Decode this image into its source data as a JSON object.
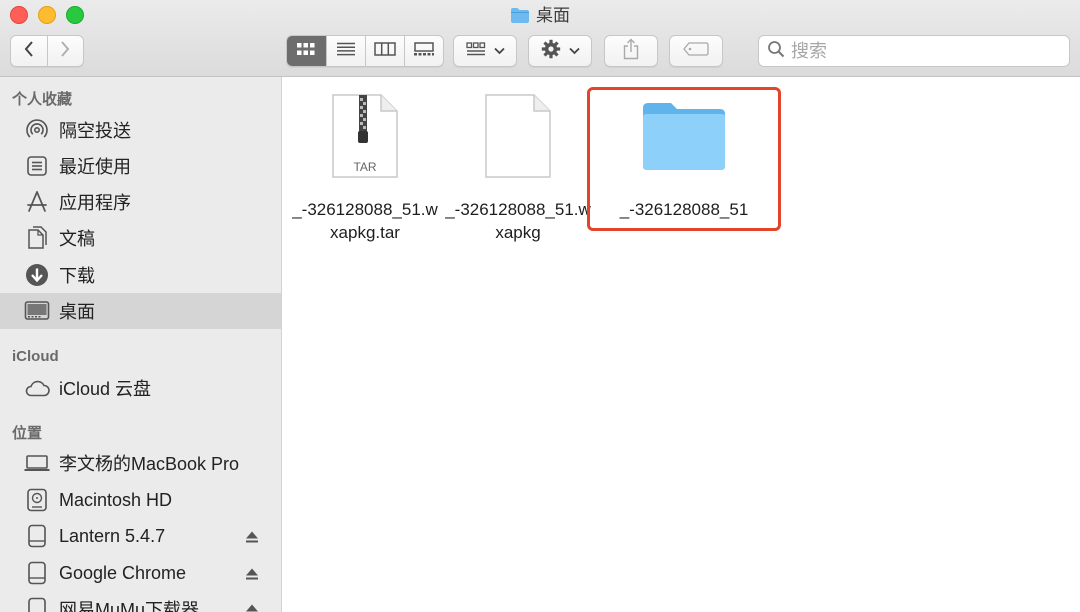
{
  "window": {
    "title": "桌面"
  },
  "toolbar": {
    "back_icon": "chevron-left-icon",
    "forward_icon": "chevron-right-icon",
    "views": [
      "icon-view-icon",
      "list-view-icon",
      "column-view-icon",
      "gallery-view-icon"
    ],
    "active_view": "icon-view-icon",
    "search_placeholder": "搜索"
  },
  "sidebar": {
    "favorites_header": "个人收藏",
    "favorites": [
      {
        "label": "隔空投送",
        "icon": "airdrop-icon"
      },
      {
        "label": "最近使用",
        "icon": "recents-icon"
      },
      {
        "label": "应用程序",
        "icon": "applications-icon"
      },
      {
        "label": "文稿",
        "icon": "documents-icon"
      },
      {
        "label": "下载",
        "icon": "downloads-icon"
      },
      {
        "label": "桌面",
        "icon": "desktop-icon",
        "selected": true
      }
    ],
    "icloud_header": "iCloud",
    "icloud": [
      {
        "label": "iCloud 云盘",
        "icon": "cloud-icon"
      }
    ],
    "locations_header": "位置",
    "locations": [
      {
        "label": "李文杨的MacBook Pro",
        "icon": "laptop-icon"
      },
      {
        "label": "Macintosh HD",
        "icon": "hard-drive-icon"
      },
      {
        "label": "Lantern 5.4.7",
        "icon": "disk-image-icon",
        "eject": true
      },
      {
        "label": "Google Chrome",
        "icon": "disk-image-icon",
        "eject": true
      },
      {
        "label": "网易MuMu下载器",
        "icon": "disk-image-icon",
        "eject": true
      }
    ]
  },
  "files": [
    {
      "name": "_-326128088_51.wxapkg.tar",
      "kind": "tar-archive",
      "badge": "TAR"
    },
    {
      "name": "_-326128088_51.wxapkg",
      "kind": "document"
    },
    {
      "name": "_-326128088_51",
      "kind": "folder",
      "highlighted": true
    }
  ],
  "colors": {
    "highlight": "#e2442c",
    "folder": "#6cc0f5"
  }
}
